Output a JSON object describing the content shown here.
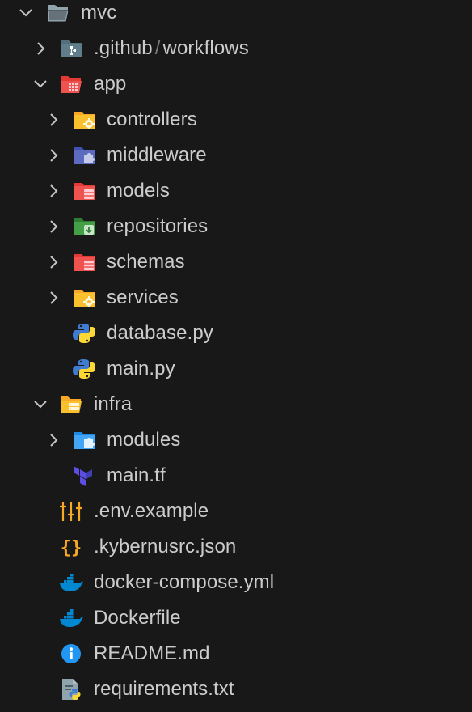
{
  "explorer": {
    "root": {
      "label": "mvc",
      "expanded": true,
      "icon": "folder-open-icon"
    },
    "items": [
      {
        "label": ".github",
        "suffix": "workflows",
        "separator": "/",
        "expanded": false,
        "icon": "github-folder-icon"
      },
      {
        "label": "app",
        "expanded": true,
        "icon": "app-folder-open-icon"
      },
      {
        "label": "controllers",
        "expanded": false,
        "icon": "controllers-folder-icon"
      },
      {
        "label": "middleware",
        "expanded": false,
        "icon": "middleware-folder-icon"
      },
      {
        "label": "models",
        "expanded": false,
        "icon": "models-folder-icon"
      },
      {
        "label": "repositories",
        "expanded": false,
        "icon": "repositories-folder-icon"
      },
      {
        "label": "schemas",
        "expanded": false,
        "icon": "schemas-folder-icon"
      },
      {
        "label": "services",
        "expanded": false,
        "icon": "services-folder-icon"
      },
      {
        "label": "database.py",
        "icon": "python-file-icon"
      },
      {
        "label": "main.py",
        "icon": "python-file-icon"
      },
      {
        "label": "infra",
        "expanded": true,
        "icon": "infra-folder-open-icon"
      },
      {
        "label": "modules",
        "expanded": false,
        "icon": "modules-folder-icon"
      },
      {
        "label": "main.tf",
        "icon": "terraform-file-icon"
      },
      {
        "label": ".env.example",
        "icon": "env-file-icon"
      },
      {
        "label": ".kybernusrc.json",
        "icon": "json-file-icon"
      },
      {
        "label": "docker-compose.yml",
        "icon": "docker-file-icon"
      },
      {
        "label": "Dockerfile",
        "icon": "docker-file-icon"
      },
      {
        "label": "README.md",
        "icon": "info-file-icon"
      },
      {
        "label": "requirements.txt",
        "icon": "requirements-file-icon"
      }
    ]
  },
  "colors": {
    "background": "#181818",
    "text": "#cccccc",
    "folder_gray": "#90a4ae",
    "folder_red": "#ef5350",
    "folder_yellow": "#fbc02d",
    "folder_indigo": "#5c6bc0",
    "folder_green": "#43a047",
    "folder_blue": "#42a5f5",
    "python_blue": "#3f7bd1",
    "python_yellow": "#fdd835",
    "terraform_purple": "#5c4ee5",
    "json_orange": "#f9a825",
    "docker_blue": "#0288d1",
    "info_blue": "#2196f3"
  }
}
